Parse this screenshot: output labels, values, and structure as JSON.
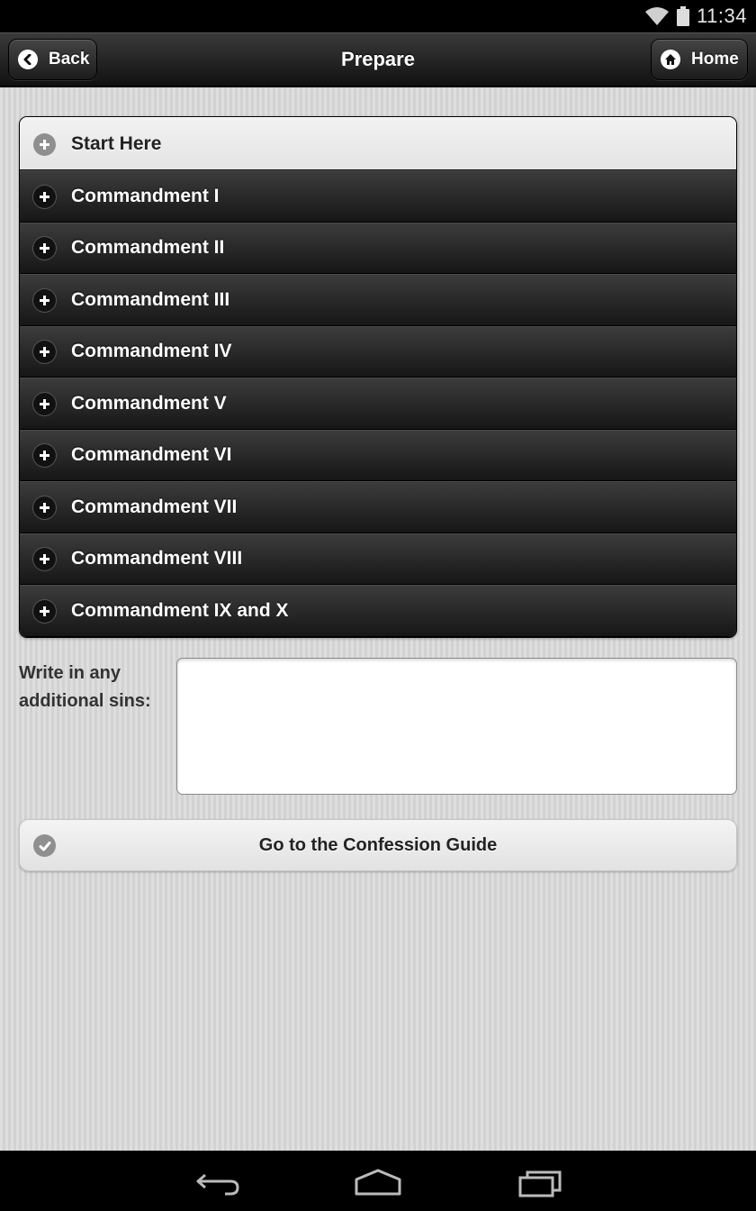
{
  "status_bar": {
    "time": "11:34",
    "icons": [
      "wifi-icon",
      "battery-icon"
    ]
  },
  "header": {
    "title": "Prepare",
    "back_label": "Back",
    "home_label": "Home"
  },
  "accordion": {
    "items": [
      {
        "label": "Start Here",
        "active": true
      },
      {
        "label": "Commandment I"
      },
      {
        "label": "Commandment II"
      },
      {
        "label": "Commandment III"
      },
      {
        "label": "Commandment IV"
      },
      {
        "label": "Commandment V"
      },
      {
        "label": "Commandment VI"
      },
      {
        "label": "Commandment VII"
      },
      {
        "label": "Commandment VIII"
      },
      {
        "label": "Commandment IX and X"
      }
    ]
  },
  "form": {
    "sins_label": "Write in any additional sins:",
    "sins_value": "",
    "guide_button_label": "Go to the Confession Guide"
  },
  "colors": {
    "header_bg": "#1c1c1c",
    "content_bg": "#d8d8d8",
    "item_dark": "#262626",
    "item_light": "#ececec"
  },
  "nav_bar": {
    "icons": [
      "back-nav-icon",
      "home-nav-icon",
      "recent-apps-icon"
    ]
  }
}
